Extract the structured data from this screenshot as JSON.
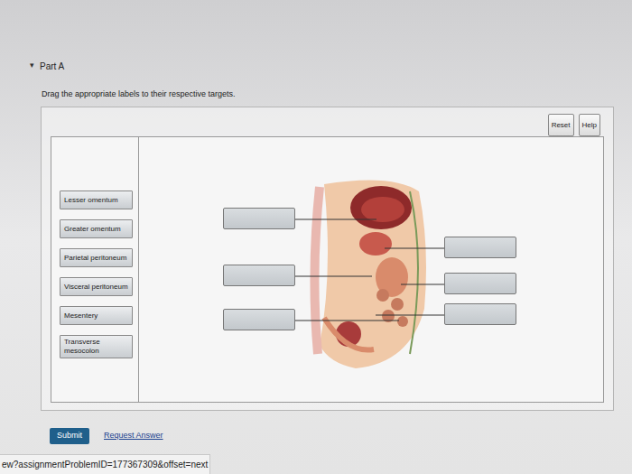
{
  "part": {
    "arrow": "▾",
    "title": "Part A"
  },
  "instruction": "Drag the appropriate labels to their respective targets.",
  "toolbar": [
    "Reset",
    "Help"
  ],
  "labels": [
    "Lesser omentum",
    "Greater omentum",
    "Parietal peritoneum",
    "Visceral peritoneum",
    "Mesentery",
    "Transverse mesocolon"
  ],
  "actions": {
    "submit": "Submit",
    "request": "Request Answer"
  },
  "status_bar": "ew?assignmentProblemID=177367309&offset=next"
}
